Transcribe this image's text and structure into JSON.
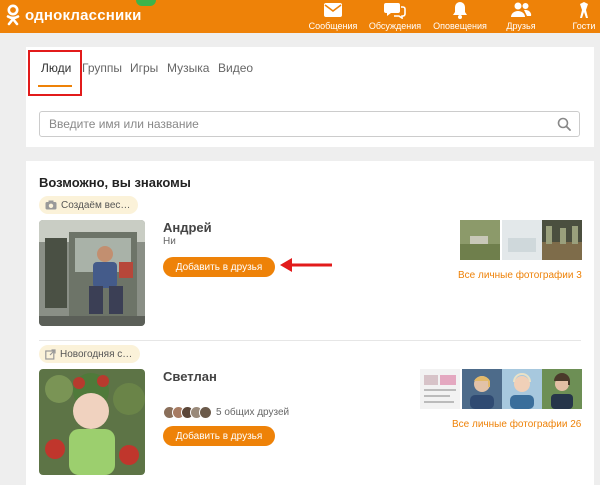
{
  "header": {
    "logo_text": "одноклассники",
    "nav": [
      {
        "label": "Сообщения",
        "icon": "envelope-icon"
      },
      {
        "label": "Обсуждения",
        "icon": "discussions-icon"
      },
      {
        "label": "Оповещения",
        "icon": "bell-icon"
      },
      {
        "label": "Друзья",
        "icon": "friends-icon"
      },
      {
        "label": "Гости",
        "icon": "guests-icon"
      }
    ]
  },
  "tabs": [
    {
      "label": "Люди",
      "active": true
    },
    {
      "label": "Группы"
    },
    {
      "label": "Игры"
    },
    {
      "label": "Музыка"
    },
    {
      "label": "Видео"
    }
  ],
  "search": {
    "placeholder": "Введите имя или название",
    "value": ""
  },
  "suggestions": {
    "title": "Возможно, вы знакомы",
    "people": [
      {
        "chip": "Создаём вес…",
        "chip_icon": "camera-icon",
        "name": "Андрей",
        "sub": "Ни",
        "add_label": "Добавить в друзья",
        "photos_link": "Все личные фотографии 3"
      },
      {
        "chip": "Новогодняя с…",
        "chip_icon": "external-link-icon",
        "name": "Светлан",
        "mutual": "5 общих друзей",
        "add_label": "Добавить в друзья",
        "photos_link": "Все личные фотографии 26"
      }
    ]
  },
  "colors": {
    "accent": "#ee8208",
    "annotation": "#e21b1b",
    "chip_bg": "#fbf2d9"
  }
}
